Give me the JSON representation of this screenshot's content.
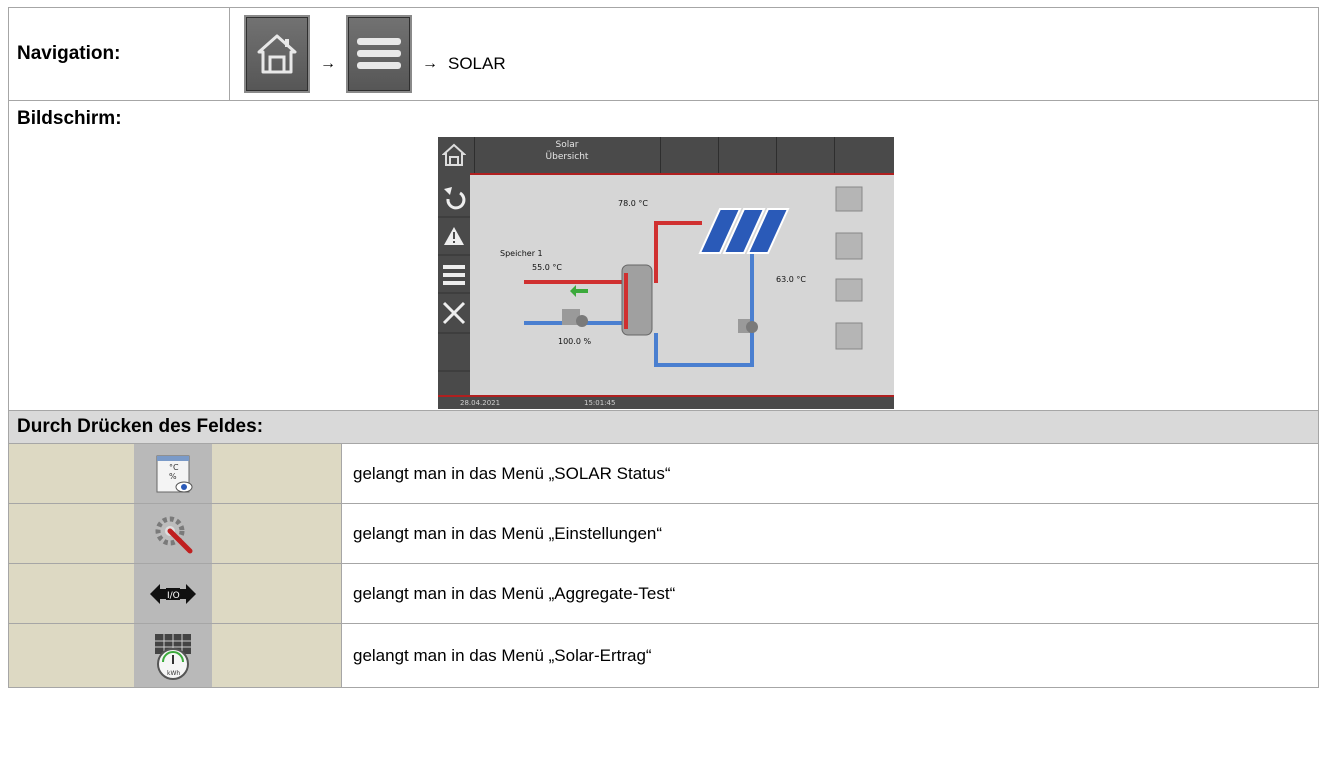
{
  "navigation": {
    "label": "Navigation:",
    "arrow1": "→",
    "arrow2": "→",
    "target": "SOLAR"
  },
  "screen_section": {
    "label": "Bildschirm:",
    "device": {
      "title_line1": "Solar",
      "title_line2": "Übersicht",
      "collector_temp": "78.0 °C",
      "storage_label": "Speicher 1",
      "storage_temp": "55.0 °C",
      "return_temp": "63.0 °C",
      "pump_percent": "100.0 %",
      "date": "28.04.2021",
      "time": "15:01:45"
    }
  },
  "pressing": {
    "header": "Durch Drücken des Feldes:",
    "items": [
      {
        "icon": "status-icon",
        "text": "gelangt man in das Menü „SOLAR Status“"
      },
      {
        "icon": "settings-icon",
        "text": "gelangt man in das Menü „Einstellungen“"
      },
      {
        "icon": "io-test-icon",
        "text": "gelangt man in das Menü „Aggregate-Test“"
      },
      {
        "icon": "solar-yield-icon",
        "text": "gelangt man in das Menü „Solar-Ertrag“"
      }
    ]
  },
  "colors": {
    "accent_red": "#b02020",
    "icon_cell_bg": "#ddd9c3",
    "header_bg": "#d9d9d9",
    "pipe_hot": "#d03030",
    "pipe_cold": "#4a7fd0"
  }
}
